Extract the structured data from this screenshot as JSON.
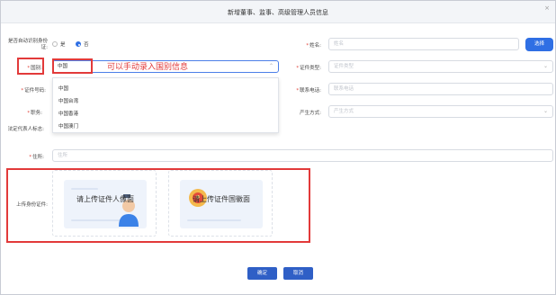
{
  "dialog": {
    "title": "新增董事、监事、高级管理人员信息",
    "close_symbol": "×"
  },
  "form": {
    "auto_id_label": "是否自动识别身份证:",
    "auto_id_options": [
      "是",
      "否"
    ],
    "auto_id_selected": "否",
    "name_label": "姓名:",
    "name_placeholder": "姓名",
    "select_button": "选择",
    "nationality_label": "国别:",
    "nationality_value": "中国",
    "id_type_label": "证件类型:",
    "id_type_placeholder": "证件类型",
    "id_number_label": "证件号码:",
    "phone_label": "联系电话:",
    "phone_placeholder": "联系电话",
    "position_label": "职务:",
    "method_label": "产生方式:",
    "method_placeholder": "产生方式",
    "legal_rep_label": "法定代表人标志:",
    "address_label": "住所:",
    "address_placeholder": "住所",
    "upload_label": "上传身份证件:",
    "upload_portrait_text": "请上传证件人像面",
    "upload_emblem_text": "请上传证件国徽面"
  },
  "nationality_dropdown": {
    "options": [
      "中国",
      "中国台湾",
      "中国香港",
      "中国澳门"
    ]
  },
  "annotation": {
    "text": "可以手动录入国别信息",
    "color": "#e23a3a"
  },
  "footer": {
    "confirm": "确定",
    "cancel": "取消"
  },
  "colors": {
    "primary": "#2f6fe4",
    "required": "#e0443a"
  }
}
